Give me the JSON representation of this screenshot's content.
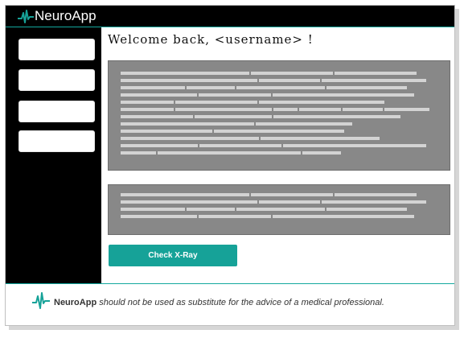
{
  "app": {
    "name": "NeuroApp",
    "accent_color": "#16a298",
    "logo_icon": "pulse-icon"
  },
  "sidebar": {
    "items": [
      {
        "label": ""
      },
      {
        "label": ""
      },
      {
        "label": ""
      },
      {
        "label": ""
      }
    ]
  },
  "main": {
    "welcome_text": "Welcome back, <username> !",
    "check_button_label": "Check X-Ray"
  },
  "footer": {
    "brand": "NeuroApp",
    "disclaimer": "should not be used as substitute for the advice of a medical professional."
  }
}
